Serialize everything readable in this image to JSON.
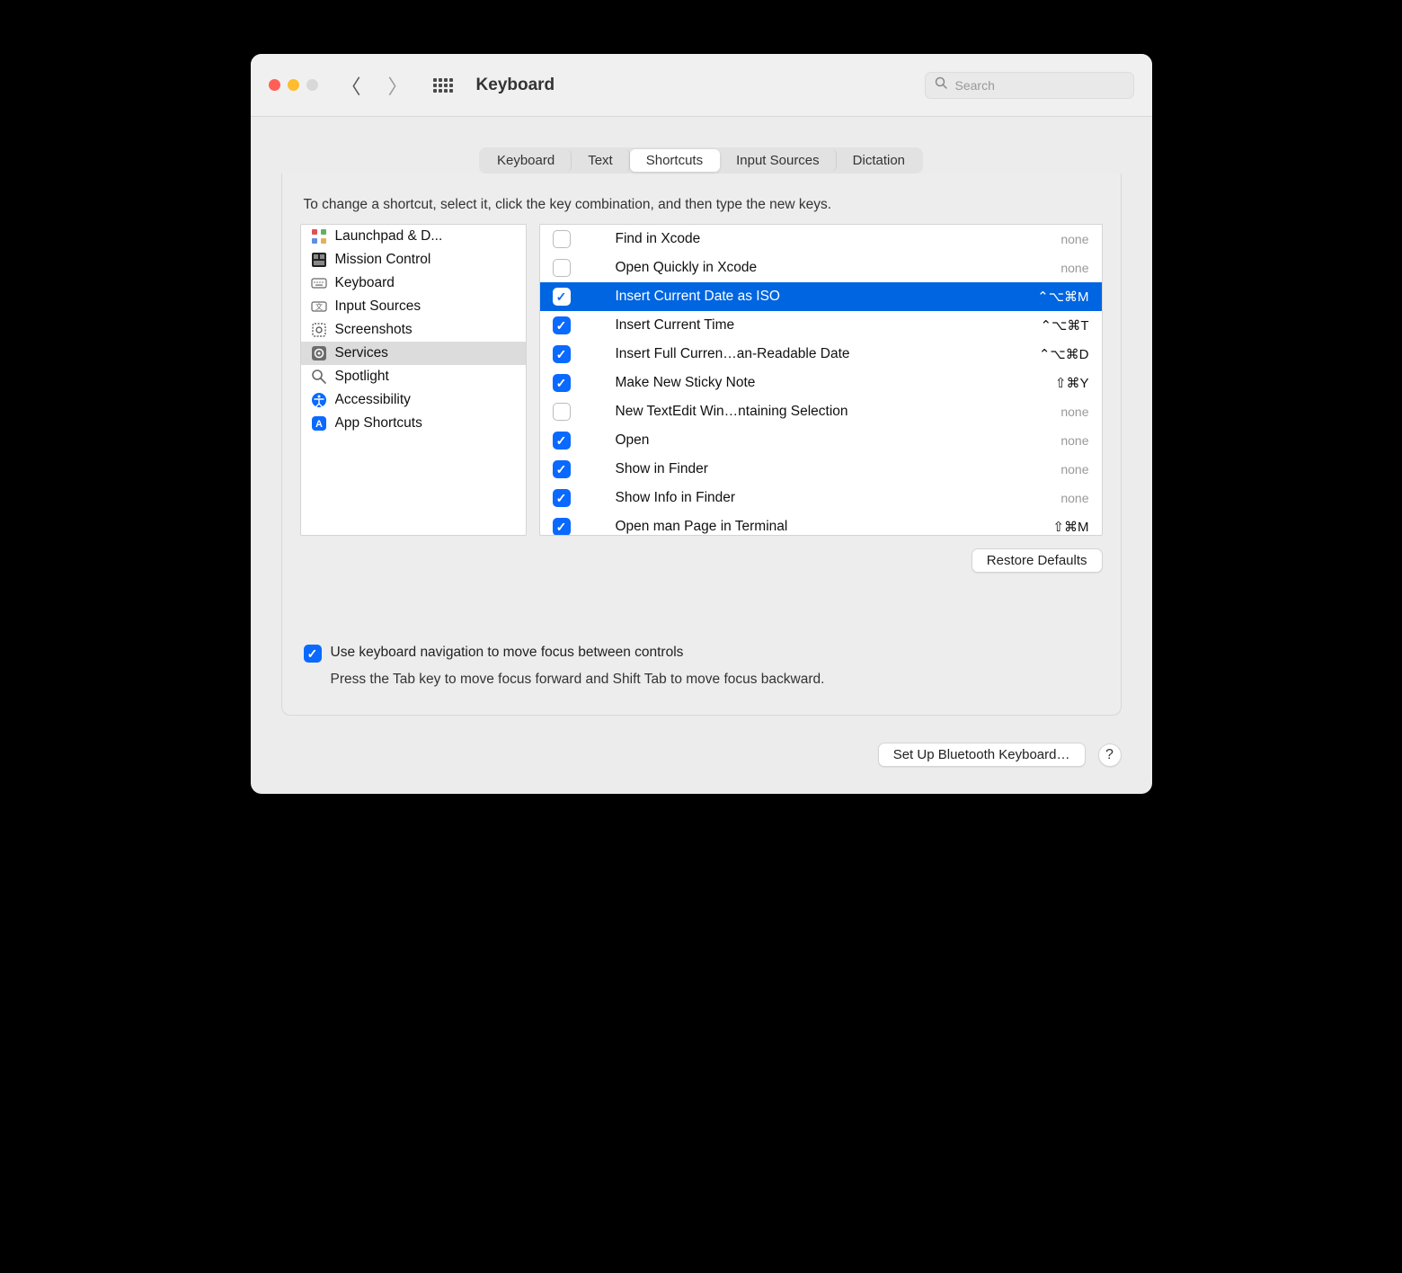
{
  "window": {
    "title": "Keyboard"
  },
  "search": {
    "placeholder": "Search"
  },
  "tabs": [
    {
      "label": "Keyboard"
    },
    {
      "label": "Text"
    },
    {
      "label": "Shortcuts",
      "selected": true
    },
    {
      "label": "Input Sources"
    },
    {
      "label": "Dictation"
    }
  ],
  "instruction": "To change a shortcut, select it, click the key combination, and then type the new keys.",
  "sidebar": {
    "items": [
      {
        "label": "Launchpad & D...",
        "icon": "launchpad"
      },
      {
        "label": "Mission Control",
        "icon": "mission"
      },
      {
        "label": "Keyboard",
        "icon": "keyboard"
      },
      {
        "label": "Input Sources",
        "icon": "input"
      },
      {
        "label": "Screenshots",
        "icon": "screenshot"
      },
      {
        "label": "Services",
        "icon": "services",
        "selected": true
      },
      {
        "label": "Spotlight",
        "icon": "spotlight"
      },
      {
        "label": "Accessibility",
        "icon": "accessibility"
      },
      {
        "label": "App Shortcuts",
        "icon": "appshortcuts"
      }
    ]
  },
  "shortcuts": [
    {
      "checked": false,
      "label": "Find in Xcode",
      "keys": "none"
    },
    {
      "checked": false,
      "label": "Open Quickly in Xcode",
      "keys": "none"
    },
    {
      "checked": true,
      "label": "Insert Current Date as ISO",
      "keys": "⌃⌥⌘M",
      "selected": true
    },
    {
      "checked": true,
      "label": "Insert Current Time",
      "keys": "⌃⌥⌘T"
    },
    {
      "checked": true,
      "label": "Insert Full Curren…an-Readable Date",
      "keys": "⌃⌥⌘D"
    },
    {
      "checked": true,
      "label": "Make New Sticky Note",
      "keys": "⇧⌘Y"
    },
    {
      "checked": false,
      "label": "New TextEdit Win…ntaining Selection",
      "keys": "none"
    },
    {
      "checked": true,
      "label": "Open",
      "keys": "none"
    },
    {
      "checked": true,
      "label": "Show in Finder",
      "keys": "none"
    },
    {
      "checked": true,
      "label": "Show Info in Finder",
      "keys": "none"
    },
    {
      "checked": true,
      "label": "Open man Page in Terminal",
      "keys": "⇧⌘M"
    }
  ],
  "restore": "Restore Defaults",
  "kbnav": {
    "checked": true,
    "label": "Use keyboard navigation to move focus between controls",
    "sub": "Press the Tab key to move focus forward and Shift Tab to move focus backward."
  },
  "footer": {
    "setup": "Set Up Bluetooth Keyboard…"
  }
}
